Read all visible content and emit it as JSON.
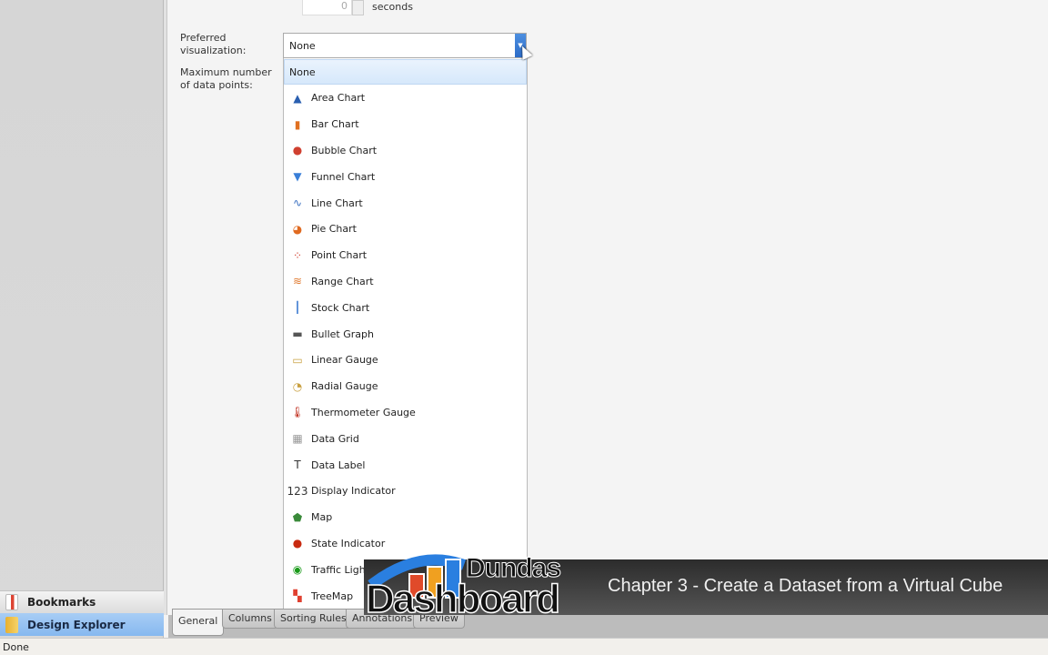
{
  "sidebar": {
    "items": [
      {
        "label": "Bookmarks",
        "icon": "bookmark-icon"
      },
      {
        "label": "Design Explorer",
        "icon": "folder-icon",
        "selected": true
      }
    ]
  },
  "form": {
    "interval_value": "0",
    "interval_unit": "seconds",
    "preferred_label": "Preferred visualization:",
    "preferred_value": "None",
    "max_points_label": "Maximum number of data points:"
  },
  "dropdown": {
    "items": [
      {
        "label": "None",
        "icon": "",
        "color": "",
        "selected": true
      },
      {
        "label": "Area Chart",
        "icon": "area-chart-icon",
        "glyph": "▲",
        "color": "#2a5fb0"
      },
      {
        "label": "Bar Chart",
        "icon": "bar-chart-icon",
        "glyph": "▮",
        "color": "#e07020"
      },
      {
        "label": "Bubble Chart",
        "icon": "bubble-chart-icon",
        "glyph": "●",
        "color": "#d04030"
      },
      {
        "label": "Funnel Chart",
        "icon": "funnel-chart-icon",
        "glyph": "▼",
        "color": "#3a7fd8"
      },
      {
        "label": "Line Chart",
        "icon": "line-chart-icon",
        "glyph": "∿",
        "color": "#3a6fc0"
      },
      {
        "label": "Pie Chart",
        "icon": "pie-chart-icon",
        "glyph": "◕",
        "color": "#e06a20"
      },
      {
        "label": "Point Chart",
        "icon": "point-chart-icon",
        "glyph": "⁘",
        "color": "#d04030"
      },
      {
        "label": "Range Chart",
        "icon": "range-chart-icon",
        "glyph": "≋",
        "color": "#e07a30"
      },
      {
        "label": "Stock Chart",
        "icon": "stock-chart-icon",
        "glyph": "┃",
        "color": "#5a8fd8"
      },
      {
        "label": "Bullet Graph",
        "icon": "bullet-graph-icon",
        "glyph": "▬",
        "color": "#555"
      },
      {
        "label": "Linear Gauge",
        "icon": "linear-gauge-icon",
        "glyph": "▭",
        "color": "#c9a040"
      },
      {
        "label": "Radial Gauge",
        "icon": "radial-gauge-icon",
        "glyph": "◔",
        "color": "#c9a040"
      },
      {
        "label": "Thermometer Gauge",
        "icon": "thermometer-icon",
        "glyph": "🌡",
        "color": "#c03020"
      },
      {
        "label": "Data Grid",
        "icon": "data-grid-icon",
        "glyph": "▦",
        "color": "#999"
      },
      {
        "label": "Data Label",
        "icon": "data-label-icon",
        "glyph": "T",
        "color": "#333"
      },
      {
        "label": "Display Indicator",
        "icon": "display-indicator-icon",
        "glyph": "123",
        "color": "#333"
      },
      {
        "label": "Map",
        "icon": "map-icon",
        "glyph": "⬟",
        "color": "#3a8a3a"
      },
      {
        "label": "State Indicator",
        "icon": "state-indicator-icon",
        "glyph": "●",
        "color": "#c82a10"
      },
      {
        "label": "Traffic Light",
        "icon": "traffic-light-icon",
        "glyph": "◉",
        "color": "#1a9a1a"
      },
      {
        "label": "TreeMap",
        "icon": "treemap-icon",
        "glyph": "▚",
        "color": "#e04030"
      }
    ]
  },
  "tabs": [
    {
      "label": "General",
      "active": true
    },
    {
      "label": "Columns"
    },
    {
      "label": "Sorting Rules"
    },
    {
      "label": "Annotations"
    },
    {
      "label": "Preview"
    }
  ],
  "banner": {
    "logo": "Dundas Dashboard",
    "chapter": "Chapter 3 - Create a Dataset from a Virtual Cube"
  },
  "status": "Done"
}
